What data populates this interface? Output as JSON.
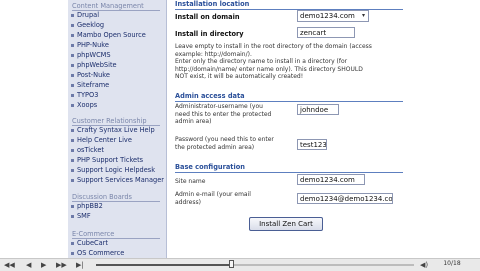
{
  "sidebar": {
    "top_category": "Content Management",
    "cms_items": [
      "Drupal",
      "Geeklog",
      "Mambo Open Source",
      "PHP-Nuke",
      "phpWCMS",
      "phpWebSite",
      "Post-Nuke",
      "Siteframe",
      "TYPO3",
      "Xoops"
    ],
    "crm_category": "Customer Relationship",
    "crm_items": [
      "Crafty Syntax Live Help",
      "Help Center Live",
      "osTicket",
      "PHP Support Tickets",
      "Support Logic Helpdesk",
      "Support Services Manager"
    ],
    "forum_category": "Discussion Boards",
    "forum_items": [
      "phpBB2",
      "SMF"
    ],
    "ecom_category": "E-Commerce",
    "ecom_items": [
      "CubeCart",
      "OS Commerce"
    ]
  },
  "form": {
    "install_location": "Installation location",
    "install_on_domain_label": "Install on domain",
    "domain_value": "demo1234.com",
    "install_dir_label": "Install in directory",
    "dir_value": "zencart",
    "dir_help_1": "Leave empty to install in the root directory of the domain (access",
    "dir_help_2": "example: http://domain/).",
    "dir_help_3": "Enter only the directory name to install in a directory (for",
    "dir_help_4": "http://domain/name/ enter name only). This directory SHOULD",
    "dir_help_5": "NOT exist, it will be automatically created!",
    "admin_access": "Admin access data",
    "admin_user_label_1": "Administrator-username (you",
    "admin_user_label_2": "need this to enter the protected",
    "admin_user_label_3": "admin area)",
    "admin_user_value": "johndoe",
    "password_label_1": "Password (you need this to enter",
    "password_label_2": "the protected admin area)",
    "password_value": "test123",
    "base_config": "Base configuration",
    "site_name_label": "Site name",
    "site_name_value": "demo1234.com",
    "admin_email_label_1": "Admin e-mail (your email",
    "admin_email_label_2": "address)",
    "admin_email_value": "demo1234@demo1234.co",
    "install_button": "Install Zen Cart"
  },
  "player": {
    "counter": "10/18",
    "progress": 0.43
  }
}
